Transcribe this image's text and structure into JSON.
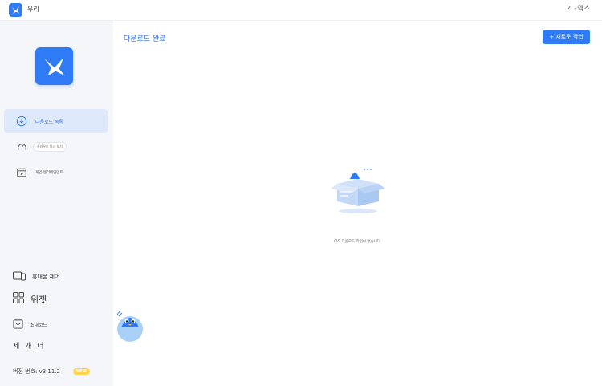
{
  "app": {
    "title": "우리",
    "window_controls": "? -엑스"
  },
  "sidebar": {
    "items": [
      {
        "label": "다운로드 목록"
      },
      {
        "label": "클라우드 다시 보기"
      },
      {
        "label": "게임 엔터테인먼트"
      }
    ],
    "bottom": {
      "phone_control": "휴대폰 제어",
      "widgets": "위젯",
      "invite_code": "초대코드",
      "world": "세 개 더"
    },
    "version": "버전 번호: v3.11.2",
    "new_badge": "NEW"
  },
  "main": {
    "title": "다운로드 완료",
    "new_task_button": "+ 새로운 작업",
    "empty_message": "아직 다운로드 작업이 없습니다"
  },
  "colors": {
    "accent": "#2f7bf5",
    "active_bg": "#dde9fb",
    "sidebar_bg": "#f4f6f9",
    "badge": "#ffd44d"
  }
}
